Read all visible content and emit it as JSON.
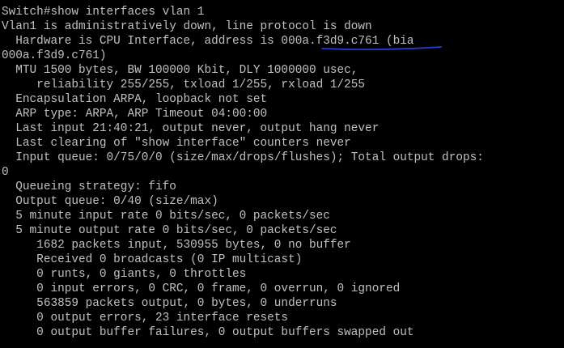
{
  "terminal": {
    "lines": [
      "Switch#show interfaces vlan 1",
      "Vlan1 is administratively down, line protocol is down",
      "  Hardware is CPU Interface, address is 000a.f3d9.c761 (bia",
      "000a.f3d9.c761)",
      "  MTU 1500 bytes, BW 100000 Kbit, DLY 1000000 usec,",
      "     reliability 255/255, txload 1/255, rxload 1/255",
      "  Encapsulation ARPA, loopback not set",
      "  ARP type: ARPA, ARP Timeout 04:00:00",
      "  Last input 21:40:21, output never, output hang never",
      "  Last clearing of \"show interface\" counters never",
      "  Input queue: 0/75/0/0 (size/max/drops/flushes); Total output drops:",
      "0",
      "  Queueing strategy: fifo",
      "  Output queue: 0/40 (size/max)",
      "  5 minute input rate 0 bits/sec, 0 packets/sec",
      "  5 minute output rate 0 bits/sec, 0 packets/sec",
      "     1682 packets input, 530955 bytes, 0 no buffer",
      "     Received 0 broadcasts (0 IP multicast)",
      "     0 runts, 0 giants, 0 throttles",
      "     0 input errors, 0 CRC, 0 frame, 0 overrun, 0 ignored",
      "     563859 packets output, 0 bytes, 0 underruns",
      "     0 output errors, 23 interface resets",
      "     0 output buffer failures, 0 output buffers swapped out"
    ]
  },
  "colors": {
    "background": "#000000",
    "text": "#c0c0c0",
    "annotation": "#1f3fd0"
  }
}
